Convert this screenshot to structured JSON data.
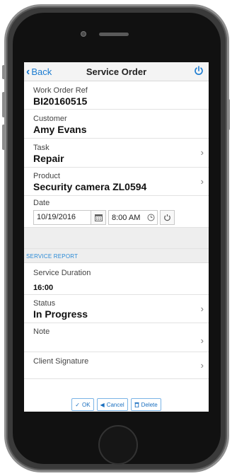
{
  "navbar": {
    "back_label": "Back",
    "title": "Service Order",
    "power_icon": "power-icon"
  },
  "fields": {
    "work_order_ref": {
      "label": "Work Order Ref",
      "value": "BI20160515"
    },
    "customer": {
      "label": "Customer",
      "value": "Amy Evans"
    },
    "task": {
      "label": "Task",
      "value": "Repair"
    },
    "product": {
      "label": "Product",
      "value": "Security camera ZL0594"
    },
    "date": {
      "label": "Date",
      "date_value": "10/19/2016",
      "time_value": "8:00 AM"
    }
  },
  "service_report": {
    "header": "SERVICE REPORT",
    "duration": {
      "label": "Service Duration",
      "value": "16:00"
    },
    "status": {
      "label": "Status",
      "value": "In Progress"
    },
    "note": {
      "label": "Note"
    },
    "signature": {
      "label": "Client Signature"
    }
  },
  "actions": {
    "ok_label": "OK",
    "cancel_label": "Cancel",
    "delete_label": "Delete"
  },
  "colors": {
    "accent": "#1a7bd1",
    "section_header_text": "#2a8ad6",
    "section_bg": "#eeeeee"
  }
}
